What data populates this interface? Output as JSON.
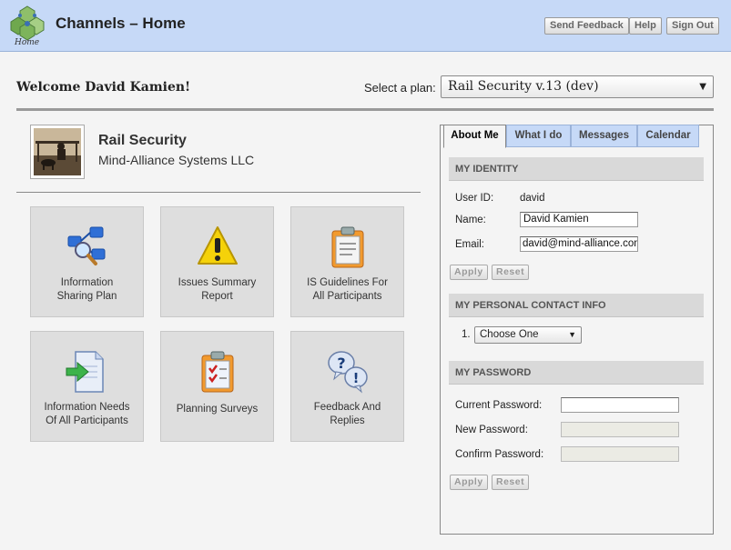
{
  "header": {
    "logo_caption": "Home",
    "title": "Channels – Home",
    "buttons": {
      "send_feedback": "Send Feedback",
      "help": "Help",
      "sign_out": "Sign Out"
    }
  },
  "welcome": {
    "text": "Welcome David Kamien!",
    "plan_label": "Select a plan:",
    "plan_selected": "Rail Security v.13 (dev)"
  },
  "plan": {
    "name": "Rail Security",
    "organization": "Mind-Alliance Systems LLC"
  },
  "tiles": [
    {
      "label_1": "Information",
      "label_2": "Sharing Plan",
      "icon": "network-search-icon"
    },
    {
      "label_1": "Issues Summary",
      "label_2": "Report",
      "icon": "warning-icon"
    },
    {
      "label_1": "IS Guidelines For",
      "label_2": "All Participants",
      "icon": "clipboard-icon"
    },
    {
      "label_1": "Information Needs",
      "label_2": "Of All Participants",
      "icon": "document-arrow-icon"
    },
    {
      "label_1": "Planning Surveys",
      "label_2": "",
      "icon": "checklist-clipboard-icon"
    },
    {
      "label_1": "Feedback And",
      "label_2": "Replies",
      "icon": "question-bubbles-icon"
    }
  ],
  "tabs": [
    "About Me",
    "What I do",
    "Messages",
    "Calendar"
  ],
  "identity": {
    "heading": "MY IDENTITY",
    "user_id_label": "User ID:",
    "user_id": "david",
    "name_label": "Name:",
    "name": "David Kamien",
    "email_label": "Email:",
    "email": "david@mind-alliance.com",
    "apply": "Apply",
    "reset": "Reset"
  },
  "contact": {
    "heading": "MY PERSONAL CONTACT INFO",
    "item_number": "1.",
    "select_value": "Choose One"
  },
  "password": {
    "heading": "MY PASSWORD",
    "current_label": "Current Password:",
    "new_label": "New Password:",
    "confirm_label": "Confirm Password:",
    "apply": "Apply",
    "reset": "Reset"
  }
}
